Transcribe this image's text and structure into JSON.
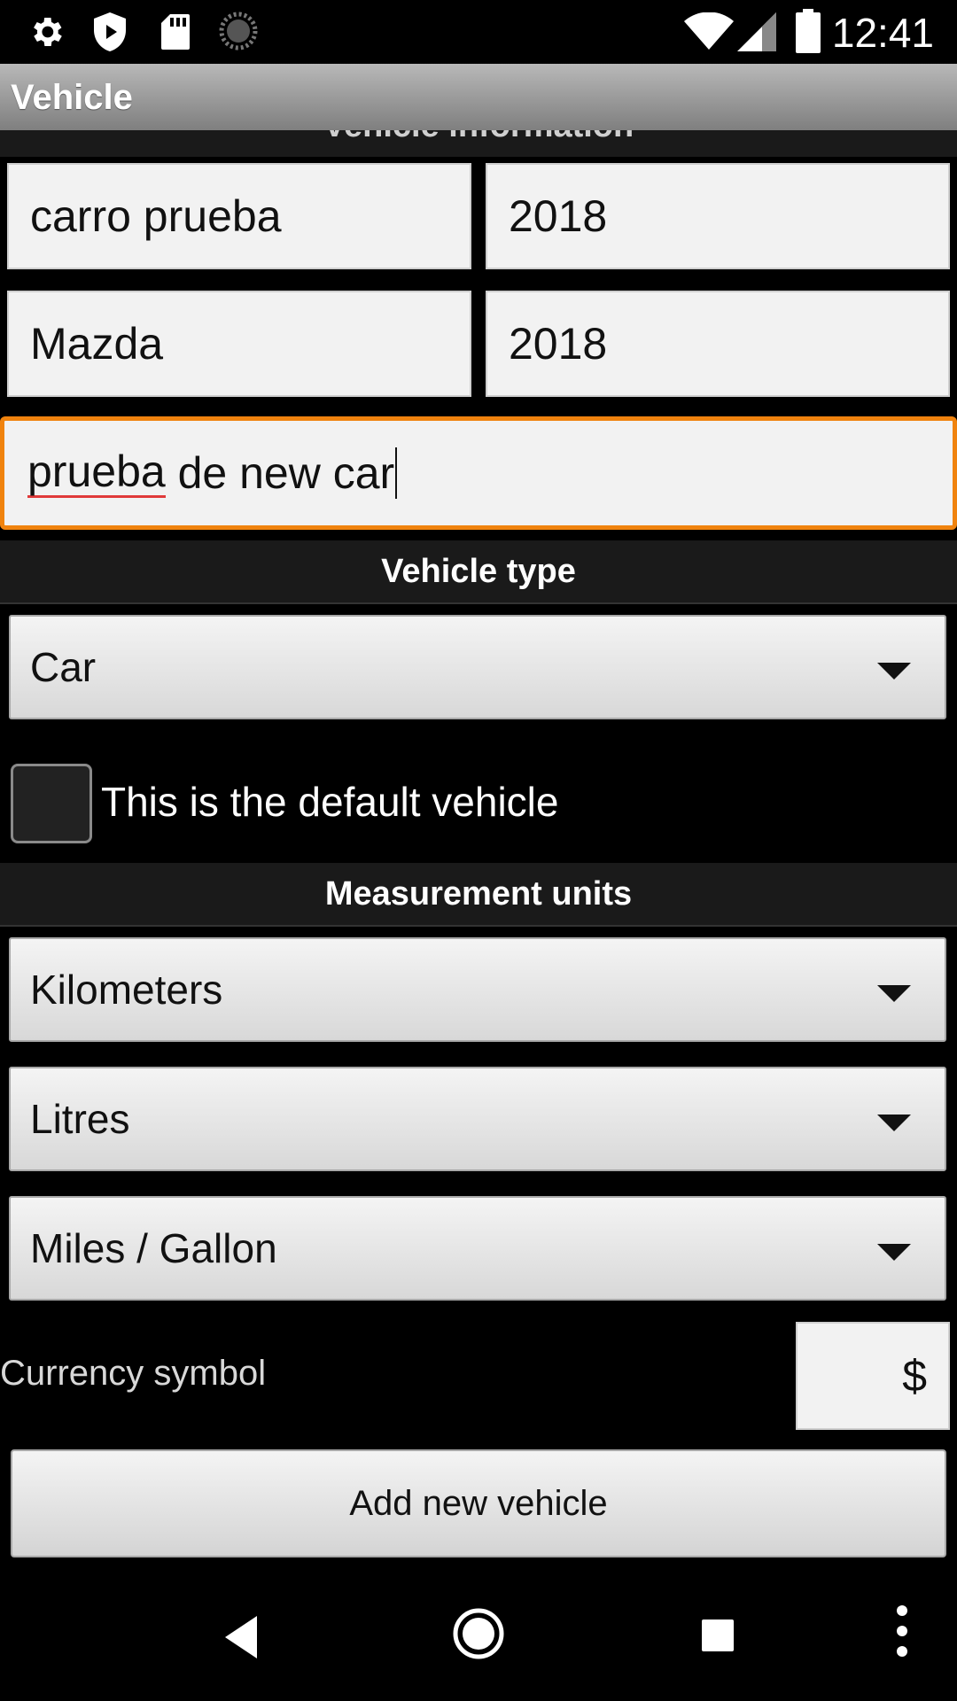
{
  "status_bar": {
    "time": "12:41",
    "icons": [
      "settings-icon",
      "play-protect-icon",
      "sd-card-icon",
      "loading-icon",
      "wifi-icon",
      "cell-signal-icon",
      "battery-icon"
    ]
  },
  "app_bar": {
    "title": "Vehicle"
  },
  "vehicle_information": {
    "header": "Vehicle information",
    "name_value": "carro prueba",
    "year_value": "2018",
    "make_value": "Mazda",
    "model_value": "2018",
    "notes_value_part1": "prueba",
    "notes_value_part2": " de new car"
  },
  "vehicle_type": {
    "header": "Vehicle type",
    "selected": "Car"
  },
  "default_vehicle": {
    "label": "This is the default vehicle",
    "checked": false
  },
  "measurement_units": {
    "header": "Measurement units",
    "distance": "Kilometers",
    "volume": "Litres",
    "consumption": "Miles / Gallon"
  },
  "currency": {
    "label": "Currency symbol",
    "value": "$"
  },
  "actions": {
    "add_label": "Add new vehicle"
  },
  "colors": {
    "focus_accent": "#f0830e",
    "spellcheck": "#e03a3a"
  }
}
